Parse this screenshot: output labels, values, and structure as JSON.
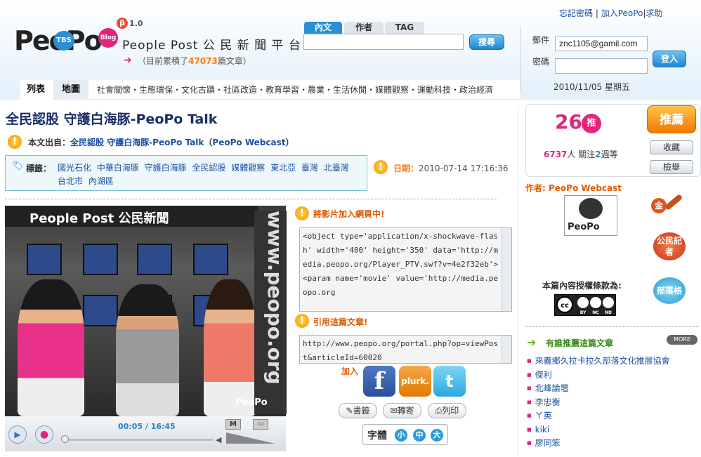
{
  "header": {
    "logo_text": "PeoPo",
    "logo_tbs": "TBS",
    "logo_blog": "Blog",
    "beta_symbol": "β",
    "version": "1.0",
    "site_title": "People Post 公 民 新 聞 平 台",
    "article_count_prefix": "（目前累積了",
    "article_count": "47073",
    "article_count_suffix": "篇文章）",
    "search_tabs": [
      "內文",
      "作者",
      "TAG"
    ],
    "search_value": "",
    "search_button": "搜尋",
    "top_links": [
      "忘記密碼",
      "加入PeoPo",
      "求助"
    ],
    "email_label": "郵件",
    "password_label": "密碼",
    "email_value": "znc1105@gamil.com",
    "password_value": "",
    "login_button": "登入",
    "date": "2010/11/05 星期五"
  },
  "nav": {
    "list_tab": "列表",
    "map_tab": "地圖",
    "categories": "社會關懷・生態環保・文化古蹟・社區改造・教育學習・農業・生活休閒・媒體觀察・運動科技・政治經濟"
  },
  "article": {
    "title": "全民認股 守護白海豚-PeoPo Talk",
    "source_label": "本文出自：",
    "source_link": "全民認股 守護白海豚-PeoPo Talk",
    "source_paren_open": "（",
    "source_author": "PeoPo Webcast",
    "source_paren_close": "）",
    "tags_label": "標籤：",
    "tags": "國光石化 中華白海豚 守護白海豚 全民認股 媒體觀察 東北亞 臺灣 北臺灣 台北市 內湖區",
    "date_label": "日期：",
    "date_value": "2010-07-14 17:16:36"
  },
  "video": {
    "banner": "People Post 公民新聞",
    "side_text": "www.peopo.org",
    "watermark": "PeoPo",
    "timecode": "00:05 / 16:45",
    "m_label": "M",
    "play_glyph": "▶",
    "record_glyph": "●"
  },
  "share": {
    "embed_title": "將影片加入網頁中!",
    "embed_code": "<object type='application/x-shockwave-flash' width='400' height='350' data='http://media.peopo.org/Player_PTV.swf?v=4e2f32eb'>  <param name='movie' value='http://media.peopo.org",
    "cite_title": "引用這篇文章!",
    "cite_url": "http://www.peopo.org/portal.php?op=viewPost&articleId=60020",
    "join_label": "加入",
    "facebook": "f",
    "plurk": "plurk.",
    "twitter": "t",
    "bookmark": "書籤",
    "forward": "轉寄",
    "print": "列印",
    "font_size_label": "字體",
    "font_small": "小",
    "font_mid": "中",
    "font_big": "大"
  },
  "sidebar": {
    "rec_count": "26",
    "rec_badge": "推",
    "recommend_button": "推薦",
    "followers_count": "6737",
    "followers_mid": "人 關注",
    "weeks": "2",
    "weeks_suffix": "週等",
    "collect_button": "收藏",
    "report_button": "檢舉",
    "author_label": "作者: PeoPo Webcast",
    "avatar_logo": "PeoPo",
    "gold_badge": "金",
    "reporter_badge": "公民記者",
    "blog_badge": "部落格",
    "license_label": "本篇內容授權條款為:",
    "cc_text": "cc BY NC ND",
    "recommenders_title": "有誰推薦這篇文章",
    "more_button": "MORE",
    "recommenders": [
      "來義鄉久拉卡拉久部落文化推展協會",
      "傑利",
      "北峰論壇",
      "李忠衡",
      "ㄚ英",
      "kiki",
      "廖同笨"
    ]
  },
  "colors": {
    "accent_blue": "#2a8fd4",
    "accent_pink": "#e0267a",
    "accent_orange": "#ff7a00",
    "title_navy": "#1a2f6b"
  }
}
